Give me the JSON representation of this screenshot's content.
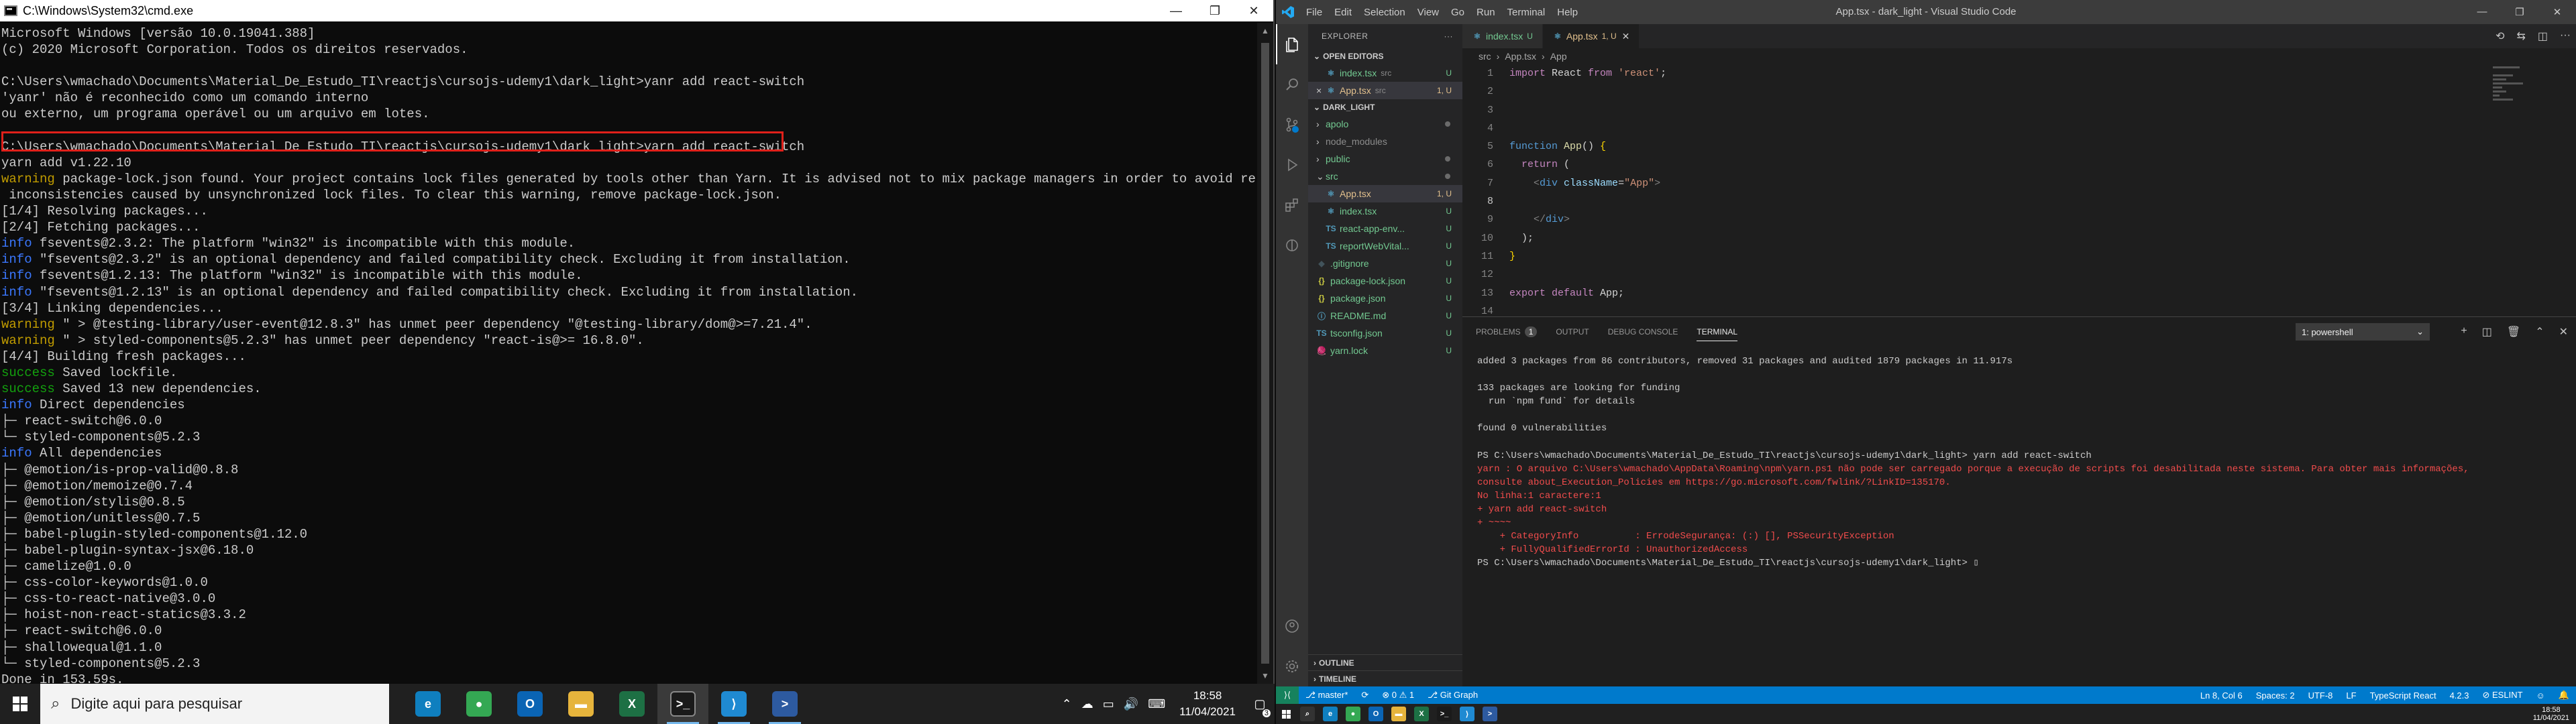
{
  "cmd": {
    "title": "C:\\Windows\\System32\\cmd.exe",
    "lines": [
      [
        {
          "t": "Microsoft Windows [versão 10.0.19041.388]",
          "c": "gray"
        }
      ],
      [
        {
          "t": "(c) 2020 Microsoft Corporation. Todos os direitos reservados.",
          "c": "gray"
        }
      ],
      [
        {
          "t": "",
          "c": "gray"
        }
      ],
      [
        {
          "t": "C:\\Users\\wmachado\\Documents\\Material_De_Estudo_TI\\reactjs\\cursojs-udemy1\\dark_light>yanr add react-switch",
          "c": "gray"
        }
      ],
      [
        {
          "t": "'yanr' não é reconhecido como um comando interno",
          "c": "gray"
        }
      ],
      [
        {
          "t": "ou externo, um programa operável ou um arquivo em lotes.",
          "c": "gray"
        }
      ],
      [
        {
          "t": "",
          "c": "gray"
        }
      ],
      [
        {
          "t": "C:\\Users\\wmachado\\Documents\\Material_De_Estudo_TI\\reactjs\\cursojs-udemy1\\dark_light>yarn add react-switch",
          "c": "gray"
        }
      ],
      [
        {
          "t": "yarn add v1.22.10",
          "c": "gray"
        }
      ],
      [
        {
          "t": "warning",
          "c": "yellow"
        },
        {
          "t": " package-lock.json found. Your project contains lock files generated by tools other than Yarn. It is advised not to mix package managers in order to avoid resolution",
          "c": "gray"
        }
      ],
      [
        {
          "t": " inconsistencies caused by unsynchronized lock files. To clear this warning, remove package-lock.json.",
          "c": "gray"
        }
      ],
      [
        {
          "t": "[1/4] Resolving packages...",
          "c": "gray"
        }
      ],
      [
        {
          "t": "[2/4] Fetching packages...",
          "c": "gray"
        }
      ],
      [
        {
          "t": "info",
          "c": "blue"
        },
        {
          "t": " fsevents@2.3.2: The platform \"win32\" is incompatible with this module.",
          "c": "gray"
        }
      ],
      [
        {
          "t": "info",
          "c": "blue"
        },
        {
          "t": " \"fsevents@2.3.2\" is an optional dependency and failed compatibility check. Excluding it from installation.",
          "c": "gray"
        }
      ],
      [
        {
          "t": "info",
          "c": "blue"
        },
        {
          "t": " fsevents@1.2.13: The platform \"win32\" is incompatible with this module.",
          "c": "gray"
        }
      ],
      [
        {
          "t": "info",
          "c": "blue"
        },
        {
          "t": " \"fsevents@1.2.13\" is an optional dependency and failed compatibility check. Excluding it from installation.",
          "c": "gray"
        }
      ],
      [
        {
          "t": "[3/4] Linking dependencies...",
          "c": "gray"
        }
      ],
      [
        {
          "t": "warning",
          "c": "yellow"
        },
        {
          "t": " \" > @testing-library/user-event@12.8.3\" has unmet peer dependency \"@testing-library/dom@>=7.21.4\".",
          "c": "gray"
        }
      ],
      [
        {
          "t": "warning",
          "c": "yellow"
        },
        {
          "t": " \" > styled-components@5.2.3\" has unmet peer dependency \"react-is@>= 16.8.0\".",
          "c": "gray"
        }
      ],
      [
        {
          "t": "[4/4] Building fresh packages...",
          "c": "gray"
        }
      ],
      [
        {
          "t": "success",
          "c": "green"
        },
        {
          "t": " Saved lockfile.",
          "c": "gray"
        }
      ],
      [
        {
          "t": "success",
          "c": "green"
        },
        {
          "t": " Saved 13 new dependencies.",
          "c": "gray"
        }
      ],
      [
        {
          "t": "info",
          "c": "blue"
        },
        {
          "t": " Direct dependencies",
          "c": "gray"
        }
      ],
      [
        {
          "t": "├─ react-switch@6.0.0",
          "c": "gray"
        }
      ],
      [
        {
          "t": "└─ styled-components@5.2.3",
          "c": "gray"
        }
      ],
      [
        {
          "t": "info",
          "c": "blue"
        },
        {
          "t": " All dependencies",
          "c": "gray"
        }
      ],
      [
        {
          "t": "├─ @emotion/is-prop-valid@0.8.8",
          "c": "gray"
        }
      ],
      [
        {
          "t": "├─ @emotion/memoize@0.7.4",
          "c": "gray"
        }
      ],
      [
        {
          "t": "├─ @emotion/stylis@0.8.5",
          "c": "gray"
        }
      ],
      [
        {
          "t": "├─ @emotion/unitless@0.7.5",
          "c": "gray"
        }
      ],
      [
        {
          "t": "├─ babel-plugin-styled-components@1.12.0",
          "c": "gray"
        }
      ],
      [
        {
          "t": "├─ babel-plugin-syntax-jsx@6.18.0",
          "c": "gray"
        }
      ],
      [
        {
          "t": "├─ camelize@1.0.0",
          "c": "gray"
        }
      ],
      [
        {
          "t": "├─ css-color-keywords@1.0.0",
          "c": "gray"
        }
      ],
      [
        {
          "t": "├─ css-to-react-native@3.0.0",
          "c": "gray"
        }
      ],
      [
        {
          "t": "├─ hoist-non-react-statics@3.3.2",
          "c": "gray"
        }
      ],
      [
        {
          "t": "├─ react-switch@6.0.0",
          "c": "gray"
        }
      ],
      [
        {
          "t": "├─ shallowequal@1.1.0",
          "c": "gray"
        }
      ],
      [
        {
          "t": "└─ styled-components@5.2.3",
          "c": "gray"
        }
      ],
      [
        {
          "t": "Done in 153.59s.",
          "c": "gray"
        }
      ]
    ]
  },
  "vscode": {
    "menus": [
      "File",
      "Edit",
      "Selection",
      "View",
      "Go",
      "Run",
      "Terminal",
      "Help"
    ],
    "title": "App.tsx - dark_light - Visual Studio Code",
    "explorer": {
      "header": "EXPLORER",
      "open_editors_label": "OPEN EDITORS",
      "open_editors": [
        {
          "name": "index.tsx",
          "path": "src",
          "status": "U",
          "close": ""
        },
        {
          "name": "App.tsx",
          "path": "src",
          "status": "1, U",
          "close": "×"
        }
      ],
      "project_label": "DARK_LIGHT",
      "tree": [
        {
          "name": "apolo",
          "kind": "folder",
          "arrow": "›",
          "status": "dot"
        },
        {
          "name": "node_modules",
          "kind": "folder",
          "arrow": "›",
          "status": ""
        },
        {
          "name": "public",
          "kind": "folder",
          "arrow": "›",
          "status": "dot"
        },
        {
          "name": "src",
          "kind": "folder-open",
          "arrow": "⌄",
          "status": "dot"
        },
        {
          "name": "App.tsx",
          "kind": "tsx",
          "arrow": "",
          "status": "1, U",
          "sel": true
        },
        {
          "name": "index.tsx",
          "kind": "tsx",
          "arrow": "",
          "status": "U"
        },
        {
          "name": "react-app-env...",
          "kind": "ts",
          "arrow": "",
          "status": "U"
        },
        {
          "name": "reportWebVital...",
          "kind": "ts",
          "arrow": "",
          "status": "U"
        },
        {
          "name": ".gitignore",
          "kind": "git",
          "arrow": "",
          "status": "U"
        },
        {
          "name": "package-lock.json",
          "kind": "json",
          "arrow": "",
          "status": "U"
        },
        {
          "name": "package.json",
          "kind": "json",
          "arrow": "",
          "status": "U"
        },
        {
          "name": "README.md",
          "kind": "md",
          "arrow": "",
          "status": "U"
        },
        {
          "name": "tsconfig.json",
          "kind": "tsconfig",
          "arrow": "",
          "status": "U"
        },
        {
          "name": "yarn.lock",
          "kind": "yarn",
          "arrow": "",
          "status": "U"
        }
      ],
      "outline_label": "OUTLINE",
      "timeline_label": "TIMELINE"
    },
    "tabs": [
      {
        "label": "index.tsx",
        "suffix": "U",
        "active": false
      },
      {
        "label": "App.tsx",
        "suffix": "1, U",
        "active": true
      }
    ],
    "breadcrumb": [
      "src",
      "›",
      "App.tsx",
      "›",
      "App"
    ],
    "code": [
      [
        {
          "t": "import",
          "c": "k1"
        },
        {
          "t": " React ",
          "c": "pl"
        },
        {
          "t": "from",
          "c": "k1"
        },
        {
          "t": " 'react'",
          "c": "str"
        },
        {
          "t": ";",
          "c": "pl"
        }
      ],
      [],
      [],
      [],
      [
        {
          "t": "function",
          "c": "k2"
        },
        {
          "t": " App",
          "c": "k3"
        },
        {
          "t": "() ",
          "c": "pl"
        },
        {
          "t": "{",
          "c": "br"
        }
      ],
      [
        {
          "t": "  return",
          "c": "k1"
        },
        {
          "t": " (",
          "c": "pl"
        }
      ],
      [
        {
          "t": "    ",
          "c": "pl"
        },
        {
          "t": "<",
          "c": "ang"
        },
        {
          "t": "div",
          "c": "k2"
        },
        {
          "t": " className",
          "c": "k4"
        },
        {
          "t": "=",
          "c": "pl"
        },
        {
          "t": "\"App\"",
          "c": "str"
        },
        {
          "t": ">",
          "c": "ang"
        }
      ],
      [],
      [
        {
          "t": "    ",
          "c": "pl"
        },
        {
          "t": "</",
          "c": "ang"
        },
        {
          "t": "div",
          "c": "k2"
        },
        {
          "t": ">",
          "c": "ang"
        }
      ],
      [
        {
          "t": "  );",
          "c": "pl"
        }
      ],
      [
        {
          "t": "}",
          "c": "br"
        }
      ],
      [],
      [
        {
          "t": "export",
          "c": "k1"
        },
        {
          "t": " default",
          "c": "k1"
        },
        {
          "t": " App",
          "c": "pl"
        },
        {
          "t": ";",
          "c": "pl"
        }
      ],
      []
    ],
    "panel": {
      "tabs": [
        {
          "label": "PROBLEMS",
          "count": "1",
          "active": false
        },
        {
          "label": "OUTPUT",
          "count": "",
          "active": false
        },
        {
          "label": "DEBUG CONSOLE",
          "count": "",
          "active": false
        },
        {
          "label": "TERMINAL",
          "count": "",
          "active": true
        }
      ],
      "shell": "1: powershell",
      "lines": [
        {
          "t": "added 3 packages from 86 contributors, removed 31 packages and audited 1879 packages in 11.917s",
          "c": ""
        },
        {
          "t": "",
          "c": ""
        },
        {
          "t": "133 packages are looking for funding",
          "c": ""
        },
        {
          "t": "  run `npm fund` for details",
          "c": ""
        },
        {
          "t": "",
          "c": ""
        },
        {
          "t": "found 0 vulnerabilities",
          "c": ""
        },
        {
          "t": "",
          "c": ""
        },
        {
          "t": "PS C:\\Users\\wmachado\\Documents\\Material_De_Estudo_TI\\reactjs\\cursojs-udemy1\\dark_light> yarn add react-switch",
          "c": ""
        },
        {
          "t": "yarn : O arquivo C:\\Users\\wmachado\\AppData\\Roaming\\npm\\yarn.ps1 não pode ser carregado porque a execução de scripts foi desabilitada neste sistema. Para obter mais informações,",
          "c": "red"
        },
        {
          "t": "consulte about_Execution_Policies em https://go.microsoft.com/fwlink/?LinkID=135170.",
          "c": "red"
        },
        {
          "t": "No linha:1 caractere:1",
          "c": "red"
        },
        {
          "t": "+ yarn add react-switch",
          "c": "red"
        },
        {
          "t": "+ ~~~~",
          "c": "red"
        },
        {
          "t": "    + CategoryInfo          : ErrodeSegurança: (:) [], PSSecurityException",
          "c": "red"
        },
        {
          "t": "    + FullyQualifiedErrorId : UnauthorizedAccess",
          "c": "red"
        },
        {
          "t": "PS C:\\Users\\wmachado\\Documents\\Material_De_Estudo_TI\\reactjs\\cursojs-udemy1\\dark_light> ▯",
          "c": ""
        }
      ]
    },
    "status": {
      "branch": "master*",
      "errors": "⊗ 0 ⚠ 1",
      "git_graph": "Git Graph",
      "position": "Ln 8, Col 6",
      "spaces": "Spaces: 2",
      "encoding": "UTF-8",
      "eol": "LF",
      "language": "TypeScript React",
      "version": "4.2.3",
      "eslint": "⊘ ESLINT"
    }
  },
  "taskbar": {
    "search_placeholder": "Digite aqui para pesquisar",
    "time": "18:58",
    "date": "11/04/2021",
    "notifications": "3",
    "apps": [
      {
        "name": "edge",
        "label": "e",
        "color": "#0f7fbf",
        "open": false
      },
      {
        "name": "chrome",
        "label": "●",
        "color": "#34a853",
        "open": false
      },
      {
        "name": "outlook",
        "label": "O",
        "color": "#0a64b4",
        "open": false
      },
      {
        "name": "file-explorer",
        "label": "▬",
        "color": "#e6b43c",
        "open": false
      },
      {
        "name": "excel",
        "label": "X",
        "color": "#1d7044",
        "open": false
      },
      {
        "name": "cmd",
        "label": ">_",
        "color": "#1a1a1a",
        "open": true,
        "active": true
      },
      {
        "name": "vscode",
        "label": "⟩",
        "color": "#1f8ad2",
        "open": true
      },
      {
        "name": "powershell",
        "label": ">",
        "color": "#2d5aa0",
        "open": true
      }
    ],
    "right_time": "18:58",
    "right_date": "11/04/2021"
  }
}
